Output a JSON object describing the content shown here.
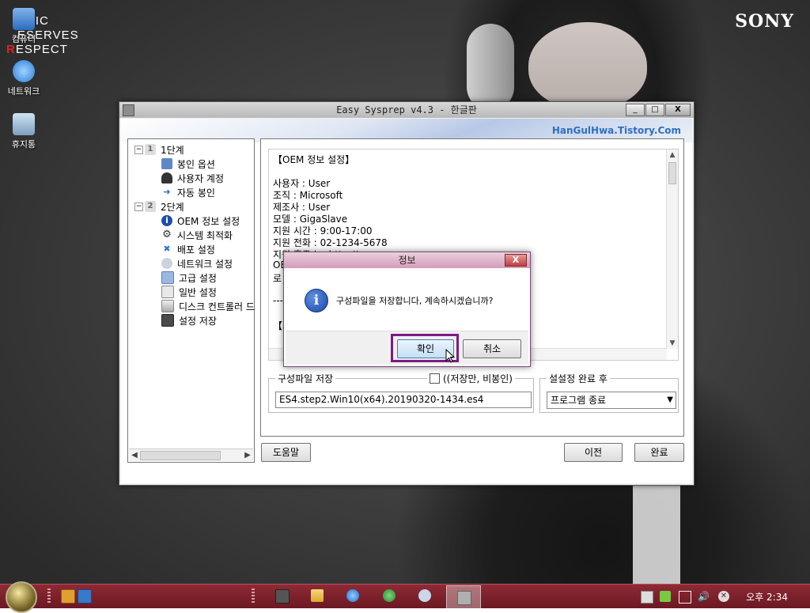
{
  "desktop": {
    "brand": "SONY",
    "mrr_lines": [
      "USIC",
      "ESERVES",
      "ESPECT"
    ],
    "icons": [
      {
        "label": "컴퓨터"
      },
      {
        "label": "네트워크"
      },
      {
        "label": "휴지통"
      }
    ]
  },
  "window": {
    "title": "Easy Sysprep v4.3 - 한글판",
    "banner": "HanGulHwa.Tistory.Com",
    "controls": {
      "minimize": "_",
      "maximize": "□",
      "close": "X"
    },
    "tree": [
      {
        "label": "1단계",
        "num": "1",
        "expander": "−"
      },
      {
        "label": "봉인 옵션"
      },
      {
        "label": "사용자 계정"
      },
      {
        "label": "자동 봉인"
      },
      {
        "label": "2단계",
        "num": "2",
        "expander": "−"
      },
      {
        "label": "OEM 정보 설정"
      },
      {
        "label": "시스템 최적화"
      },
      {
        "label": "배포 설정"
      },
      {
        "label": "네트워크 설정"
      },
      {
        "label": "고급 설정"
      },
      {
        "label": "일반 설정"
      },
      {
        "label": "디스크 컨트롤러 드"
      },
      {
        "label": "설정 저장"
      }
    ],
    "text_lines": [
      "【OEM 정보 설정】",
      "",
      "사용자 : User",
      "조직 : Microsoft",
      "제조사 : User",
      "모델 : GigaSlave",
      "지원 시간 : 9:00-17:00",
      "지원 전화 : 02-1234-5678",
      "지원 홈주소 : http://www.naver.com",
      "OE",
      "로",
      "",
      "---",
      "",
      "【시"
    ],
    "save_group_label": "구성파일 저장",
    "save_only_checkbox": "((저장만, 비봉인)",
    "file_name": "ES4.step2.Win10(x64).20190320-1434.es4",
    "after_group_label": "설설정 완료 후",
    "after_select_value": "프로그램 종료",
    "help_button": "도움말",
    "prev_button": "이전",
    "finish_button": "완료"
  },
  "dialog": {
    "title": "정보",
    "close": "X",
    "icon": "info-icon",
    "message": "구성파일을 저장합니다, 계속하시겠습니까?",
    "ok": "확인",
    "cancel": "취소"
  },
  "taskbar": {
    "clock": "오후 2:34"
  }
}
